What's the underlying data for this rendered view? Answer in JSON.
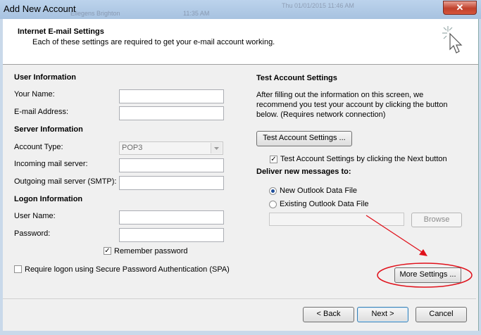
{
  "window": {
    "title": "Add New Account",
    "close_glyph": "✕",
    "background_text": [
      "Thu 01/01/2015 11:46 AM",
      "Ellegens Brighton",
      "11:35 AM"
    ]
  },
  "header": {
    "title": "Internet E-mail Settings",
    "subtitle": "Each of these settings are required to get your e-mail account working.",
    "icon": "wizard-cursor-icon"
  },
  "left": {
    "user_info": {
      "heading": "User Information",
      "your_name_label": "Your Name:",
      "your_name_value": "",
      "email_label": "E-mail Address:",
      "email_value": ""
    },
    "server_info": {
      "heading": "Server Information",
      "account_type_label": "Account Type:",
      "account_type_value": "POP3",
      "incoming_label": "Incoming mail server:",
      "incoming_value": "",
      "outgoing_label": "Outgoing mail server (SMTP):",
      "outgoing_value": ""
    },
    "logon_info": {
      "heading": "Logon Information",
      "username_label": "User Name:",
      "username_value": "",
      "password_label": "Password:",
      "password_value": "",
      "remember_label": "Remember password",
      "remember_checked": true,
      "spa_label": "Require logon using Secure Password Authentication (SPA)",
      "spa_checked": false
    }
  },
  "right": {
    "test_heading": "Test Account Settings",
    "test_desc": "After filling out the information on this screen, we recommend you test your account by clicking the button below. (Requires network connection)",
    "test_button": "Test Account Settings ...",
    "test_next_label": "Test Account Settings by clicking the Next button",
    "test_next_checked": true,
    "deliver_heading": "Deliver new messages to:",
    "new_file_label": "New Outlook Data File",
    "existing_file_label": "Existing Outlook Data File",
    "existing_path_value": "",
    "browse_button": "Browse",
    "more_settings_button": "More Settings ..."
  },
  "footer": {
    "back_button": "< Back",
    "next_button": "Next >",
    "cancel_button": "Cancel"
  },
  "colors": {
    "annotation_red": "#e0101a",
    "titlebar": "#a7c2e0",
    "dialog_bg": "#f0f0f0"
  }
}
